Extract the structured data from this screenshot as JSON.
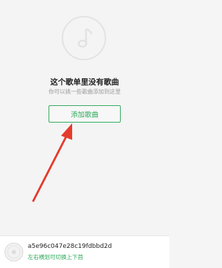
{
  "empty_state": {
    "title": "这个歌单里没有歌曲",
    "subtitle": "你可以挑一些歌曲添加到这里",
    "add_button_label": "添加歌曲"
  },
  "player_bar": {
    "track_title": "a5e96c047e28c19fdbbd2d",
    "hint": "左右横划可切换上下首"
  },
  "colors": {
    "accent": "#2eaa5a",
    "arrow": "#e53b2c"
  }
}
